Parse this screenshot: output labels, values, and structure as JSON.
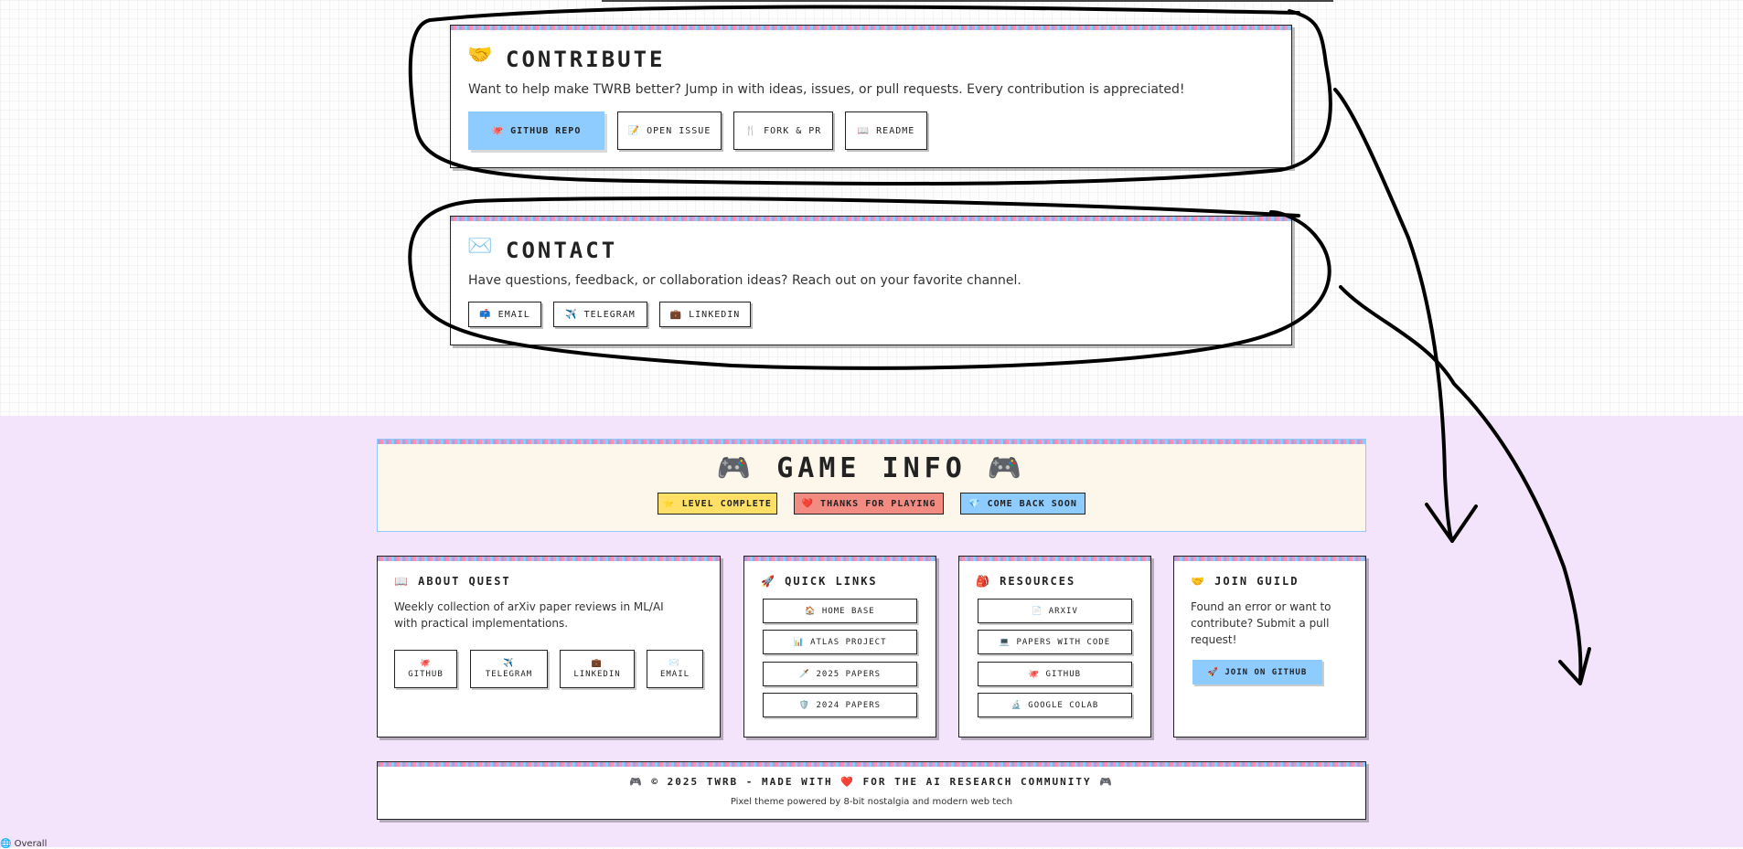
{
  "contribute": {
    "icon": "🤝",
    "title": "CONTRIBUTE",
    "description": "Want to help make TWRB better? Jump in with ideas, issues, or pull requests. Every contribution is appreciated!",
    "buttons": [
      "🐙 GITHUB REPO",
      "📝 OPEN ISSUE",
      "🍴 FORK & PR",
      "📖 README"
    ]
  },
  "contact": {
    "icon": "✉️",
    "title": "CONTACT",
    "description": "Have questions, feedback, or collaboration ideas? Reach out on your favorite channel.",
    "buttons": [
      "📫 EMAIL",
      "✈️ TELEGRAM",
      "💼 LINKEDIN"
    ]
  },
  "game_info": {
    "title": "🎮 GAME INFO 🎮",
    "badges": [
      "⭐ LEVEL COMPLETE",
      "❤️ THANKS FOR PLAYING",
      "💎 COME BACK SOON"
    ],
    "badge_colors": [
      "#ffe066",
      "#f28b82",
      "#8ecbff"
    ]
  },
  "about": {
    "title": "📖 ABOUT QUEST",
    "description": "Weekly collection of arXiv paper reviews in ML/AI with practical implementations.",
    "buttons": [
      {
        "icon": "🐙",
        "label": "GITHUB"
      },
      {
        "icon": "✈️",
        "label": "TELEGRAM"
      },
      {
        "icon": "💼",
        "label": "LINKEDIN"
      },
      {
        "icon": "✉️",
        "label": "EMAIL"
      }
    ]
  },
  "quick_links": {
    "title": "🚀 QUICK LINKS",
    "items": [
      "🏠 HOME BASE",
      "📊 ATLAS PROJECT",
      "🗡️ 2025 PAPERS",
      "🛡️ 2024 PAPERS"
    ]
  },
  "resources": {
    "title": "🎒 RESOURCES",
    "items": [
      "📄 ARXIV",
      "💻 PAPERS WITH CODE",
      "🐙 GITHUB",
      "🔬 GOOGLE COLAB"
    ]
  },
  "join": {
    "title": "🤝 JOIN GUILD",
    "description": "Found an error or want to contribute? Submit a pull request!",
    "button": "🚀 JOIN ON GITHUB"
  },
  "footer": {
    "line1": "🎮 © 2025 TWRB - MADE WITH ❤️ FOR THE AI RESEARCH COMMUNITY 🎮",
    "line2": "Pixel theme powered by 8-bit nostalgia and modern web tech"
  },
  "status": "🌐 Overall"
}
